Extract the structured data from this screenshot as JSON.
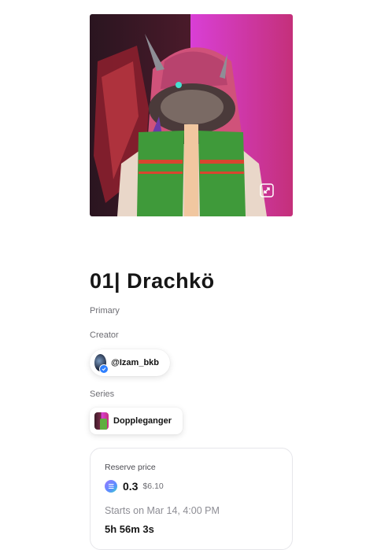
{
  "artwork": {
    "expand_icon": "expand-icon"
  },
  "title": "01| Drachkö",
  "sale_type": "Primary",
  "creator": {
    "label": "Creator",
    "handle": "@Izam_bkb",
    "verified": true
  },
  "series": {
    "label": "Series",
    "name": "Doppleganger"
  },
  "auction": {
    "reserve_label": "Reserve price",
    "price": "0.3",
    "currency_icon": "solana-icon",
    "usd": "$6.10",
    "starts": "Starts on Mar 14, 4:00 PM",
    "countdown": "5h 56m 3s"
  }
}
